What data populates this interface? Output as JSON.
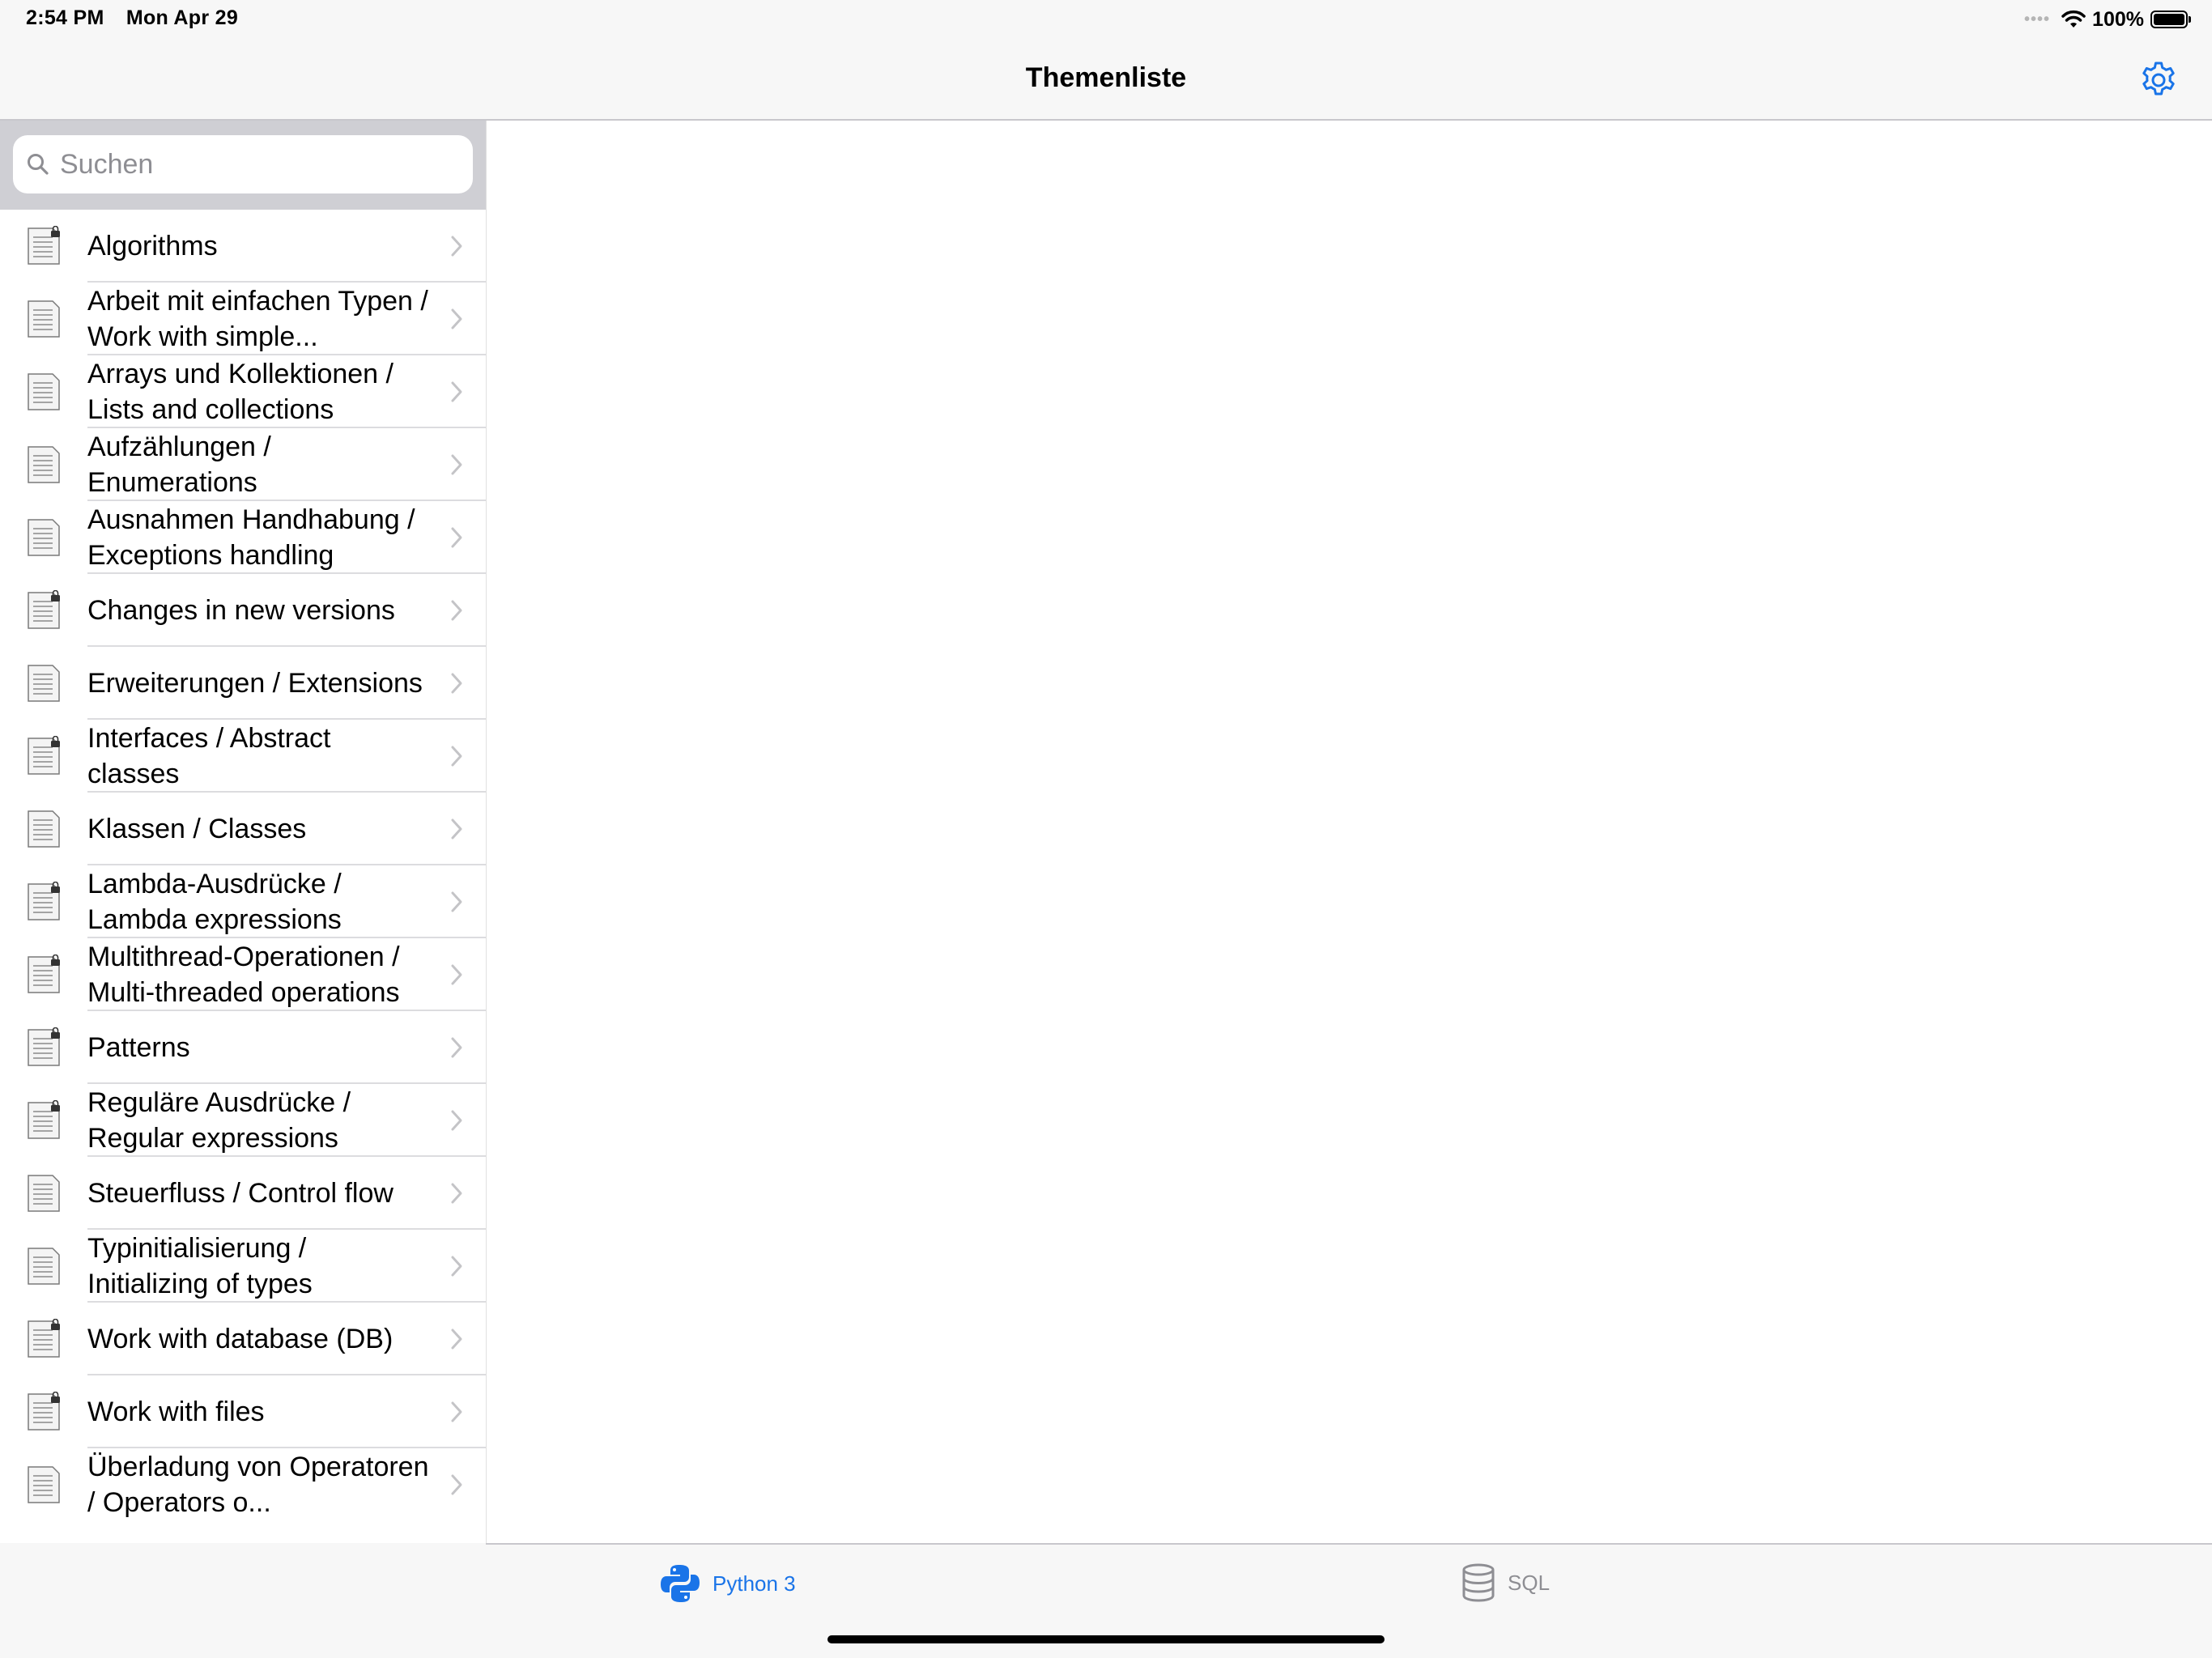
{
  "status_bar": {
    "time": "2:54 PM",
    "date": "Mon Apr 29",
    "battery": "100%"
  },
  "nav": {
    "title": "Themenliste",
    "settings_icon": "gear-icon"
  },
  "search": {
    "placeholder": "Suchen"
  },
  "topics": [
    {
      "label": "Algorithms",
      "locked": true
    },
    {
      "label": "Arbeit mit einfachen Typen / Work with simple...",
      "locked": false
    },
    {
      "label": "Arrays und Kollektionen / Lists and collections",
      "locked": false
    },
    {
      "label": "Aufzählungen / Enumerations",
      "locked": false
    },
    {
      "label": "Ausnahmen Handhabung / Exceptions handling",
      "locked": false
    },
    {
      "label": "Changes in new versions",
      "locked": true
    },
    {
      "label": "Erweiterungen / Extensions",
      "locked": false
    },
    {
      "label": "Interfaces / Abstract classes",
      "locked": true
    },
    {
      "label": "Klassen / Classes",
      "locked": false
    },
    {
      "label": "Lambda-Ausdrücke / Lambda expressions",
      "locked": true
    },
    {
      "label": "Multithread-Operationen / Multi-threaded operations",
      "locked": true
    },
    {
      "label": "Patterns",
      "locked": true
    },
    {
      "label": "Reguläre Ausdrücke / Regular expressions",
      "locked": true
    },
    {
      "label": "Steuerfluss / Control flow",
      "locked": false
    },
    {
      "label": "Typinitialisierung / Initializing of types",
      "locked": false
    },
    {
      "label": "Work with database (DB)",
      "locked": true
    },
    {
      "label": "Work with files",
      "locked": true
    },
    {
      "label": "Überladung von Operatoren / Operators o...",
      "locked": false
    }
  ],
  "tabs": [
    {
      "label": "Python 3",
      "selected": true,
      "icon": "python-icon"
    },
    {
      "label": "SQL",
      "selected": false,
      "icon": "database-icon"
    }
  ],
  "colors": {
    "accent": "#1a74e8",
    "inactive": "#8e8e93",
    "bar_background": "#f7f7f7",
    "separator": "#c8c7cc"
  }
}
